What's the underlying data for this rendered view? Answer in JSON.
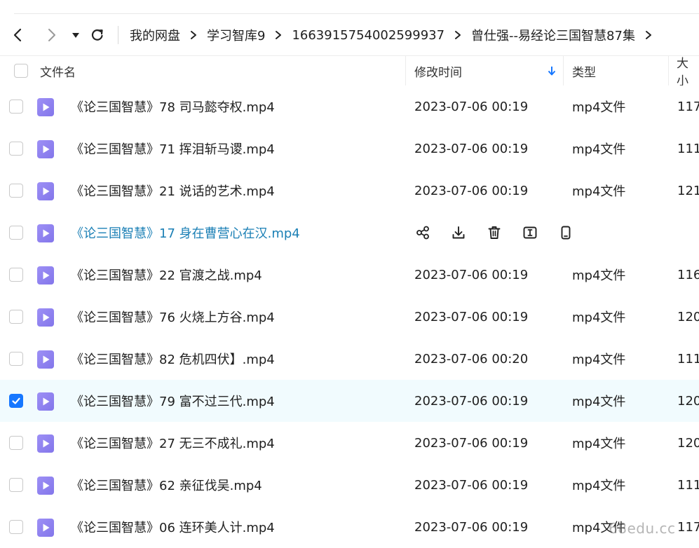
{
  "nav": {
    "back_icon": "arrow-left-icon",
    "forward_icon": "arrow-right-icon",
    "history_icon": "caret-down-icon",
    "refresh_icon": "refresh-icon"
  },
  "breadcrumb": [
    "我的网盘",
    "学习智库9",
    "1663915754002599937",
    "曾仕强--易经论三国智慧87集"
  ],
  "columns": {
    "name": "文件名",
    "modified": "修改时间",
    "type": "类型",
    "size": "大小"
  },
  "sort": {
    "column": "modified",
    "direction": "desc",
    "icon": "sort-down-arrow-icon"
  },
  "files": [
    {
      "name": "《论三国智慧》78 司马懿夺权.mp4",
      "modified": "2023-07-06 00:19",
      "type": "mp4文件",
      "size": "117",
      "checked": false
    },
    {
      "name": "《论三国智慧》71 挥泪斩马谡.mp4",
      "modified": "2023-07-06 00:19",
      "type": "mp4文件",
      "size": "111",
      "checked": false
    },
    {
      "name": "《论三国智慧》21 说话的艺术.mp4",
      "modified": "2023-07-06 00:19",
      "type": "mp4文件",
      "size": "121",
      "checked": false
    },
    {
      "name": "《论三国智慧》17 身在曹营心在汉.mp4",
      "modified": "",
      "type": "",
      "size": "",
      "checked": false,
      "hovered": true
    },
    {
      "name": "《论三国智慧》22 官渡之战.mp4",
      "modified": "2023-07-06 00:19",
      "type": "mp4文件",
      "size": "116",
      "checked": false
    },
    {
      "name": "《论三国智慧》76 火烧上方谷.mp4",
      "modified": "2023-07-06 00:19",
      "type": "mp4文件",
      "size": "120",
      "checked": false
    },
    {
      "name": "《论三国智慧》82 危机四伏】.mp4",
      "modified": "2023-07-06 00:20",
      "type": "mp4文件",
      "size": "111",
      "checked": false
    },
    {
      "name": "《论三国智慧》79 富不过三代.mp4",
      "modified": "2023-07-06 00:19",
      "type": "mp4文件",
      "size": "120",
      "checked": true
    },
    {
      "name": "《论三国智慧》27 无三不成礼.mp4",
      "modified": "2023-07-06 00:19",
      "type": "mp4文件",
      "size": "120",
      "checked": false
    },
    {
      "name": "《论三国智慧》62 亲征伐吴.mp4",
      "modified": "2023-07-06 00:19",
      "type": "mp4文件",
      "size": "111",
      "checked": false
    },
    {
      "name": "《论三国智慧》06 连环美人计.mp4",
      "modified": "2023-07-06 00:19",
      "type": "mp4文件",
      "size": "117",
      "checked": false
    }
  ],
  "row_actions": [
    "share-icon",
    "download-icon",
    "delete-icon",
    "rename-icon",
    "send-to-phone-icon"
  ],
  "watermark": "68edu.cc",
  "colors": {
    "accent": "#1677ff",
    "hover_text": "#1a7fb5",
    "selected_row": "#f1fbfe",
    "file_icon": "#8f82f0"
  }
}
